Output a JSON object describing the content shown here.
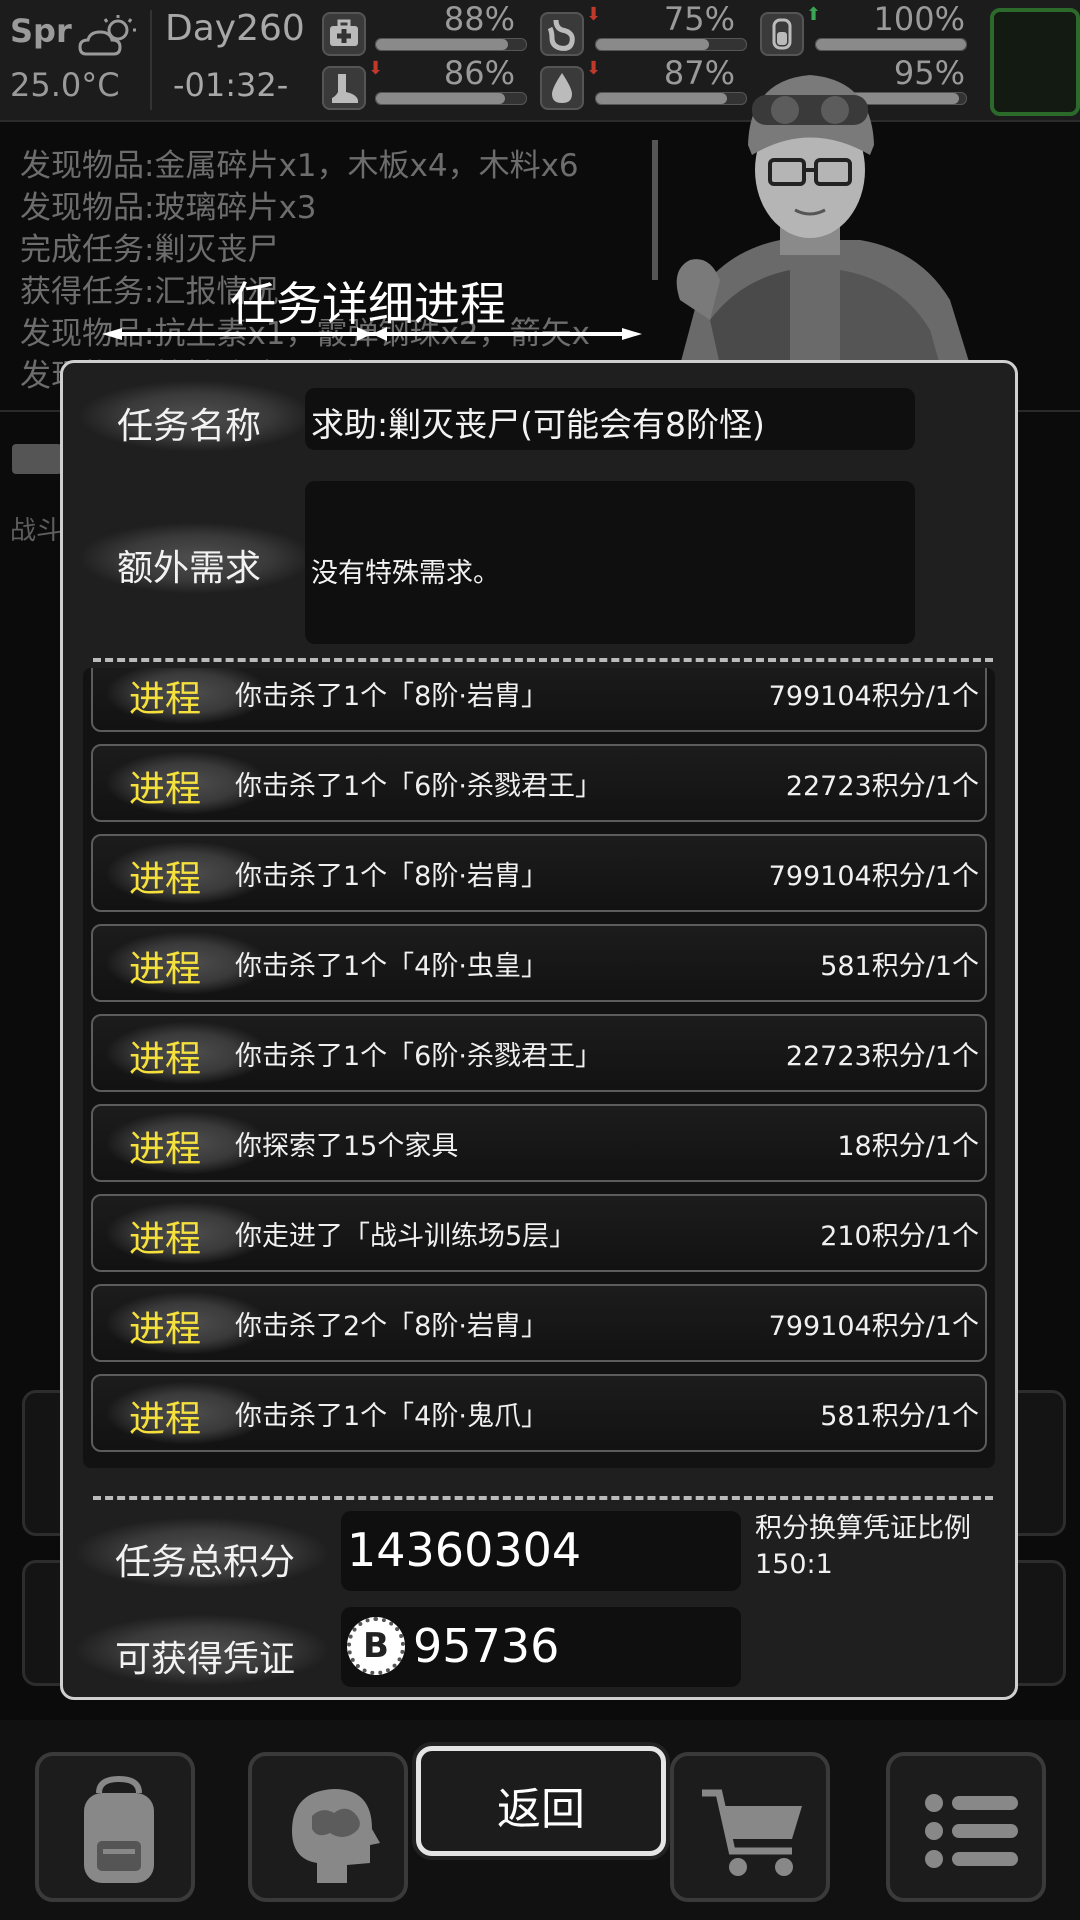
{
  "status": {
    "season": "Spr",
    "temperature": "25.0°C",
    "day": "Day260",
    "time": "-01:32-",
    "stats": [
      {
        "icon": "medkit-icon",
        "percent": "88%",
        "value": 0.88,
        "trend": ""
      },
      {
        "icon": "stomach-icon",
        "percent": "75%",
        "value": 0.75,
        "trend": "down"
      },
      {
        "icon": "battery-icon",
        "percent": "100%",
        "value": 1.0,
        "trend": "up"
      },
      {
        "icon": "foot-icon",
        "percent": "86%",
        "value": 0.86,
        "trend": "down"
      },
      {
        "icon": "water-drop-icon",
        "percent": "87%",
        "value": 0.87,
        "trend": "down"
      },
      {
        "icon": "mood-icon",
        "percent": "95%",
        "value": 0.95,
        "trend": ""
      }
    ]
  },
  "background_log": [
    "发现物品:金属碎片x1，木板x4，木料x6",
    "发现物品:玻璃碎片x3",
    "完成任务:剿灭丧尸",
    "获得任务:汇报情况",
    "发现物品:抗生素x1，霰弹钢珠x2，箭矢x",
    "发现物品:枪械改造工具包x1"
  ],
  "background_tab": "战斗",
  "dialog": {
    "title": "任务详细进程",
    "task_name_label": "任务名称",
    "task_name": "求助:剿灭丧尸(可能会有8阶怪)",
    "extra_req_label": "额外需求",
    "extra_req": "没有特殊需求。",
    "process_tag": "进程",
    "processes": [
      {
        "desc": "你击杀了1个「8阶·岩胄」",
        "points": "799104积分/1个"
      },
      {
        "desc": "你击杀了1个「6阶·杀戮君王」",
        "points": "22723积分/1个"
      },
      {
        "desc": "你击杀了1个「8阶·岩胄」",
        "points": "799104积分/1个"
      },
      {
        "desc": "你击杀了1个「4阶·虫皇」",
        "points": "581积分/1个"
      },
      {
        "desc": "你击杀了1个「6阶·杀戮君王」",
        "points": "22723积分/1个"
      },
      {
        "desc": "你探索了15个家具",
        "points": "18积分/1个"
      },
      {
        "desc": "你走进了「战斗训练场5层」",
        "points": "210积分/1个"
      },
      {
        "desc": "你击杀了2个「8阶·岩胄」",
        "points": "799104积分/1个"
      },
      {
        "desc": "你击杀了1个「4阶·鬼爪」",
        "points": "581积分/1个"
      }
    ],
    "total_points_label": "任务总积分",
    "total_points": "14360304",
    "ratio_label": "积分换算凭证比例",
    "ratio_value": "150:1",
    "voucher_label": "可获得凭证",
    "voucher_value": "95736",
    "voucher_coin": "B"
  },
  "bottom": {
    "back_label": "返回",
    "nav": [
      "backpack-icon",
      "brain-icon",
      "cart-icon",
      "menu-icon"
    ]
  }
}
